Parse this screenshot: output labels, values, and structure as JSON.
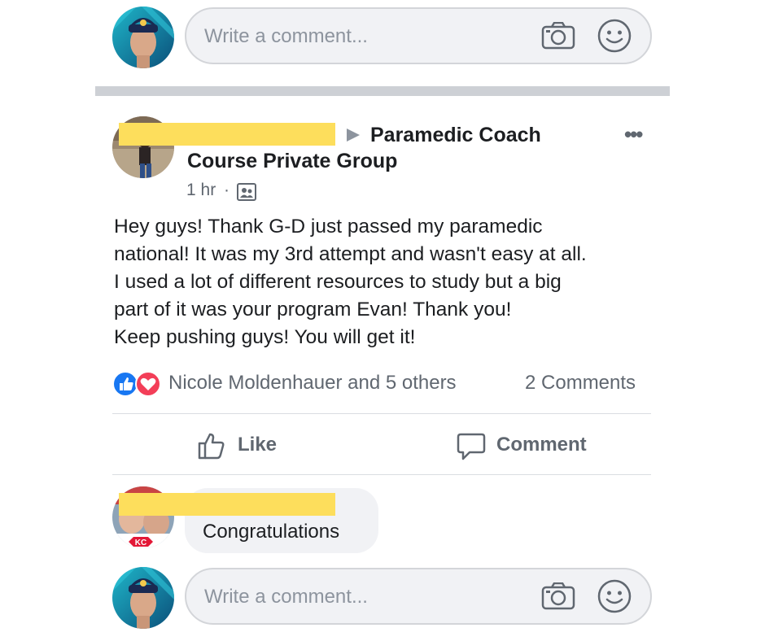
{
  "top_composer": {
    "placeholder": "Write a comment..."
  },
  "post": {
    "group_line1": "Paramedic Coach",
    "group_line2": "Course Private Group",
    "time": "1 hr",
    "separator": "·",
    "body_lines": [
      "Hey guys! Thank G-D just passed my paramedic",
      "national! It was my 3rd attempt and wasn't easy at all.",
      "I used a lot of different resources to study but a big",
      "part of it was your program Evan! Thank you!",
      "Keep pushing guys! You will get it!"
    ],
    "reactions_text": "Nicole Moldenhauer and 5 others",
    "comments_count": "2 Comments",
    "like_label": "Like",
    "comment_label": "Comment"
  },
  "comment": {
    "text": "Congratulations"
  },
  "bottom_composer": {
    "placeholder": "Write a comment..."
  },
  "colors": {
    "like_blue": "#1877f2",
    "love_red": "#f33e58",
    "redaction_yellow": "#fdde5c",
    "divider": "#cdd0d5"
  },
  "icons": [
    "camera-icon",
    "smiley-icon",
    "like-reaction-icon",
    "love-reaction-icon",
    "thumbs-up-icon",
    "speech-bubble-icon",
    "more-icon",
    "group-privacy-icon",
    "caret-right-icon"
  ]
}
